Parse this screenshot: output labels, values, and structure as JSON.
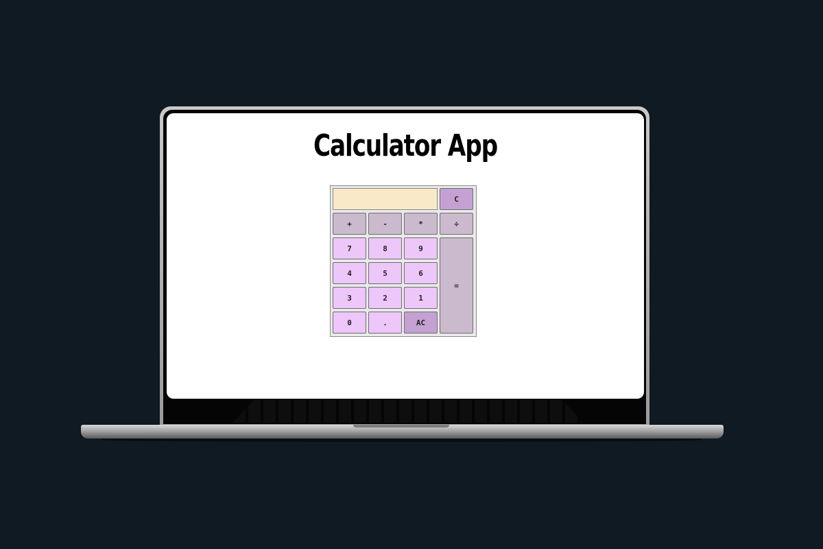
{
  "app": {
    "title": "Calculator App"
  },
  "display": {
    "value": ""
  },
  "keys": {
    "clear_entry": "C",
    "add": "+",
    "subtract": "-",
    "multiply": "*",
    "divide": "÷",
    "seven": "7",
    "eight": "8",
    "nine": "9",
    "four": "4",
    "five": "5",
    "six": "6",
    "three": "3",
    "two": "2",
    "one": "1",
    "zero": "0",
    "decimal": ".",
    "all_clear": "AC",
    "equals": "="
  },
  "colors": {
    "background": "#0f1a22",
    "display_bg": "#fae9c8",
    "number_key": "#edc6fa",
    "operator_key": "#cbb9cd",
    "clear_key": "#c4a1d2"
  }
}
